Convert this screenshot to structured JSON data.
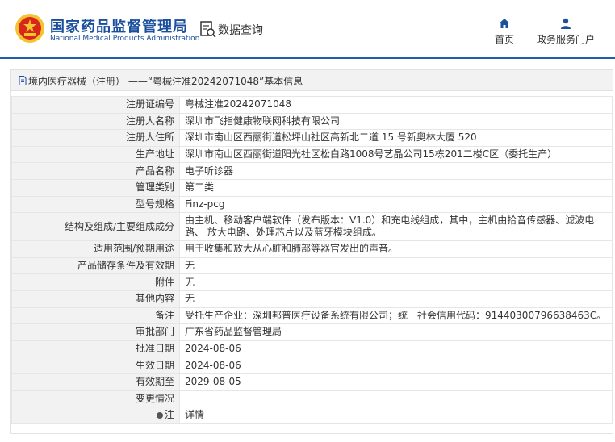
{
  "header": {
    "brand_cn": "国家药品监督管理局",
    "brand_en": "National Medical Products Administration",
    "query_label": "数据查询",
    "nav": {
      "home_label": "首页",
      "gov_service_label": "政务服务门户"
    }
  },
  "panel": {
    "title": "境内医疗器械（注册） ——“粤械注准20242071048”基本信息"
  },
  "rows": [
    {
      "label": "注册证编号",
      "value": "粤械注准20242071048"
    },
    {
      "label": "注册人名称",
      "value": "深圳市飞指健康物联网科技有限公司"
    },
    {
      "label": "注册人住所",
      "value": "深圳市南山区西丽街道松坪山社区高新北二道 15 号新奥林大厦 520"
    },
    {
      "label": "生产地址",
      "value": "深圳市南山区西丽街道阳光社区松白路1008号艺晶公司15栋201二楼C区（委托生产）"
    },
    {
      "label": "产品名称",
      "value": "电子听诊器"
    },
    {
      "label": "管理类别",
      "value": "第二类"
    },
    {
      "label": "型号规格",
      "value": "Finz-pcg"
    },
    {
      "label": "结构及组成/主要组成成分",
      "value": "由主机、移动客户端软件（发布版本：V1.0）和充电线组成，其中，主机由拾音传感器、滤波电路、 放大电路、处理芯片以及蓝牙模块组成。"
    },
    {
      "label": "适用范围/预期用途",
      "value": "用于收集和放大从心脏和肺部等器官发出的声音。"
    },
    {
      "label": "产品储存条件及有效期",
      "value": "无"
    },
    {
      "label": "附件",
      "value": "无"
    },
    {
      "label": "其他内容",
      "value": "无"
    },
    {
      "label": "备注",
      "value": "受托生产企业：深圳邦普医疗设备系统有限公司；统一社会信用代码：91440300796638463C。"
    },
    {
      "label": "审批部门",
      "value": "广东省药品监督管理局"
    },
    {
      "label": "批准日期",
      "value": "2024-08-06"
    },
    {
      "label": "生效日期",
      "value": "2024-08-06"
    },
    {
      "label": "有效期至",
      "value": "2029-08-05"
    },
    {
      "label": "变更情况",
      "value": ""
    },
    {
      "label": "注",
      "value": "详情"
    }
  ],
  "colors": {
    "brand_blue": "#1a4f9c",
    "link_blue": "#2a6fc9",
    "label_bg": "#f2f2f2"
  },
  "icons": {
    "emblem": "national-emblem-icon",
    "query": "data-query-icon",
    "home": "home-icon",
    "gov": "person-icon",
    "title": "document-icon",
    "note": "bullet-icon"
  }
}
